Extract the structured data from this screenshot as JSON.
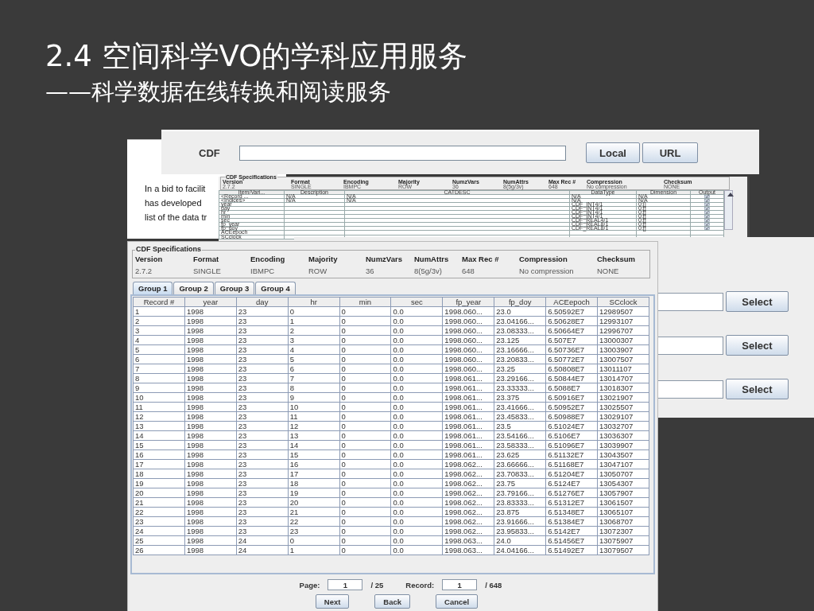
{
  "slide": {
    "title": "2.4 空间科学VO的学科应用服务",
    "subtitle": "——科学数据在线转换和阅读服务"
  },
  "document": {
    "lines": [
      "In a bid to facilit",
      "has developed",
      "list of the data tr"
    ]
  },
  "cdf_bar": {
    "label": "CDF",
    "buttons": [
      "Local",
      "URL"
    ]
  },
  "spec_window": {
    "title": "CDF Specifications",
    "fields": [
      {
        "name": "Version",
        "value": "2.7.2"
      },
      {
        "name": "Format",
        "value": "SINGLE"
      },
      {
        "name": "Encoding",
        "value": "IBMPC"
      },
      {
        "name": "Majority",
        "value": "ROW"
      },
      {
        "name": "NumzVars",
        "value": "36"
      },
      {
        "name": "NumAttrs",
        "value": "8(5g/3v)"
      },
      {
        "name": "Max Rec #",
        "value": "648"
      },
      {
        "name": "Compression",
        "value": "No compression"
      },
      {
        "name": "Checksum",
        "value": "NONE"
      }
    ],
    "columns": [
      "Item/Vari...",
      "Description",
      "CATDESC",
      "DataType",
      "Dimension",
      "Output"
    ],
    "rows": [
      {
        "name": "<Record ...",
        "description": "N/A",
        "catdesc": "N/A",
        "datatype": "N/A",
        "dimension": "N/A",
        "output": true
      },
      {
        "name": "<Indices>",
        "description": "N/A",
        "catdesc": "N/A",
        "datatype": "N/A",
        "dimension": "N/A",
        "output": true
      },
      {
        "name": "year",
        "datatype": "CDF_INT4/1",
        "dimension": "0:[]",
        "output": true
      },
      {
        "name": "day",
        "datatype": "CDF_INT4/1",
        "dimension": "0:[]",
        "output": true
      },
      {
        "name": "hr",
        "datatype": "CDF_INT4/1",
        "dimension": "0:[]",
        "output": true
      },
      {
        "name": "min",
        "datatype": "CDF_INT4/1",
        "dimension": "0:[]",
        "output": true
      },
      {
        "name": "sec",
        "datatype": "CDF_REAL4/1",
        "dimension": "0:[]",
        "output": true
      },
      {
        "name": "fp_year",
        "datatype": "CDF_REAL8/1",
        "dimension": "0:[]",
        "output": true
      },
      {
        "name": "fp_doy",
        "datatype": "CDF_REAL8/1",
        "dimension": "0:[]",
        "output": true
      },
      {
        "name": "ACEepoch"
      },
      {
        "name": "SCclock"
      }
    ]
  },
  "select_window": {
    "buttons": [
      "Select",
      "Select",
      "Select"
    ]
  },
  "main_window": {
    "title": "CDF Specifications",
    "fields": [
      {
        "name": "Version",
        "value": "2.7.2"
      },
      {
        "name": "Format",
        "value": "SINGLE"
      },
      {
        "name": "Encoding",
        "value": "IBMPC"
      },
      {
        "name": "Majority",
        "value": "ROW"
      },
      {
        "name": "NumzVars",
        "value": "36"
      },
      {
        "name": "NumAttrs",
        "value": "8(5g/3v)"
      },
      {
        "name": "Max Rec #",
        "value": "648"
      },
      {
        "name": "Compression",
        "value": "No compression"
      },
      {
        "name": "Checksum",
        "value": "NONE"
      }
    ],
    "tabs": [
      {
        "label": "Group 1",
        "selected": true
      },
      {
        "label": "Group 2",
        "selected": false
      },
      {
        "label": "Group 3",
        "selected": false
      },
      {
        "label": "Group 4",
        "selected": false
      }
    ],
    "columns": [
      "Record #",
      "year",
      "day",
      "hr",
      "min",
      "sec",
      "fp_year",
      "fp_doy",
      "ACEepoch",
      "SCclock"
    ],
    "rows": [
      [
        "1",
        "1998",
        "23",
        "0",
        "0",
        "0.0",
        "1998.060...",
        "23.0",
        "6.50592E7",
        "12989507"
      ],
      [
        "2",
        "1998",
        "23",
        "1",
        "0",
        "0.0",
        "1998.060...",
        "23.04166...",
        "6.50628E7",
        "12993107"
      ],
      [
        "3",
        "1998",
        "23",
        "2",
        "0",
        "0.0",
        "1998.060...",
        "23.08333...",
        "6.50664E7",
        "12996707"
      ],
      [
        "4",
        "1998",
        "23",
        "3",
        "0",
        "0.0",
        "1998.060...",
        "23.125",
        "6.507E7",
        "13000307"
      ],
      [
        "5",
        "1998",
        "23",
        "4",
        "0",
        "0.0",
        "1998.060...",
        "23.16666...",
        "6.50736E7",
        "13003907"
      ],
      [
        "6",
        "1998",
        "23",
        "5",
        "0",
        "0.0",
        "1998.060...",
        "23.20833...",
        "6.50772E7",
        "13007507"
      ],
      [
        "7",
        "1998",
        "23",
        "6",
        "0",
        "0.0",
        "1998.060...",
        "23.25",
        "6.50808E7",
        "13011107"
      ],
      [
        "8",
        "1998",
        "23",
        "7",
        "0",
        "0.0",
        "1998.061...",
        "23.29166...",
        "6.50844E7",
        "13014707"
      ],
      [
        "9",
        "1998",
        "23",
        "8",
        "0",
        "0.0",
        "1998.061...",
        "23.33333...",
        "6.5088E7",
        "13018307"
      ],
      [
        "10",
        "1998",
        "23",
        "9",
        "0",
        "0.0",
        "1998.061...",
        "23.375",
        "6.50916E7",
        "13021907"
      ],
      [
        "11",
        "1998",
        "23",
        "10",
        "0",
        "0.0",
        "1998.061...",
        "23.41666...",
        "6.50952E7",
        "13025507"
      ],
      [
        "12",
        "1998",
        "23",
        "11",
        "0",
        "0.0",
        "1998.061...",
        "23.45833...",
        "6.50988E7",
        "13029107"
      ],
      [
        "13",
        "1998",
        "23",
        "12",
        "0",
        "0.0",
        "1998.061...",
        "23.5",
        "6.51024E7",
        "13032707"
      ],
      [
        "14",
        "1998",
        "23",
        "13",
        "0",
        "0.0",
        "1998.061...",
        "23.54166...",
        "6.5106E7",
        "13036307"
      ],
      [
        "15",
        "1998",
        "23",
        "14",
        "0",
        "0.0",
        "1998.061...",
        "23.58333...",
        "6.51096E7",
        "13039907"
      ],
      [
        "16",
        "1998",
        "23",
        "15",
        "0",
        "0.0",
        "1998.061...",
        "23.625",
        "6.51132E7",
        "13043507"
      ],
      [
        "17",
        "1998",
        "23",
        "16",
        "0",
        "0.0",
        "1998.062...",
        "23.66666...",
        "6.51168E7",
        "13047107"
      ],
      [
        "18",
        "1998",
        "23",
        "17",
        "0",
        "0.0",
        "1998.062...",
        "23.70833...",
        "6.51204E7",
        "13050707"
      ],
      [
        "19",
        "1998",
        "23",
        "18",
        "0",
        "0.0",
        "1998.062...",
        "23.75",
        "6.5124E7",
        "13054307"
      ],
      [
        "20",
        "1998",
        "23",
        "19",
        "0",
        "0.0",
        "1998.062...",
        "23.79166...",
        "6.51276E7",
        "13057907"
      ],
      [
        "21",
        "1998",
        "23",
        "20",
        "0",
        "0.0",
        "1998.062...",
        "23.83333...",
        "6.51312E7",
        "13061507"
      ],
      [
        "22",
        "1998",
        "23",
        "21",
        "0",
        "0.0",
        "1998.062...",
        "23.875",
        "6.51348E7",
        "13065107"
      ],
      [
        "23",
        "1998",
        "23",
        "22",
        "0",
        "0.0",
        "1998.062...",
        "23.91666...",
        "6.51384E7",
        "13068707"
      ],
      [
        "24",
        "1998",
        "23",
        "23",
        "0",
        "0.0",
        "1998.062...",
        "23.95833...",
        "6.5142E7",
        "13072307"
      ],
      [
        "25",
        "1998",
        "24",
        "0",
        "0",
        "0.0",
        "1998.063...",
        "24.0",
        "6.51456E7",
        "13075907"
      ],
      [
        "26",
        "1998",
        "24",
        "1",
        "0",
        "0.0",
        "1998.063...",
        "24.04166...",
        "6.51492E7",
        "13079507"
      ]
    ],
    "pager": {
      "page_label": "Page:",
      "page": "1",
      "page_total": "/ 25",
      "record_label": "Record:",
      "record": "1",
      "record_total": "/ 648"
    },
    "buttons": [
      "Next",
      "Back",
      "Cancel"
    ]
  }
}
